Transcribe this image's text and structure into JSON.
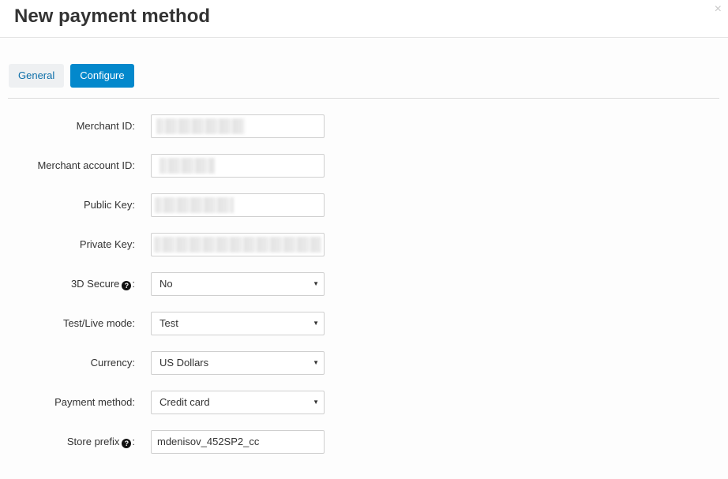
{
  "modal": {
    "title": "New payment method",
    "close_label": "×"
  },
  "tabs": [
    {
      "label": "General",
      "active": false
    },
    {
      "label": "Configure",
      "active": true
    }
  ],
  "form": {
    "merchant_id": {
      "label": "Merchant ID:",
      "value": "",
      "redacted": true
    },
    "merchant_account_id": {
      "label": "Merchant account ID:",
      "value": "",
      "redacted": true
    },
    "public_key": {
      "label": "Public Key:",
      "value": "",
      "redacted": true
    },
    "private_key": {
      "label": "Private Key:",
      "value": "",
      "redacted": true
    },
    "secure_3d": {
      "label": "3D Secure",
      "suffix": ":",
      "value": "No",
      "help": true
    },
    "mode": {
      "label": "Test/Live mode:",
      "value": "Test"
    },
    "currency": {
      "label": "Currency:",
      "value": "US Dollars"
    },
    "payment_method": {
      "label": "Payment method:",
      "value": "Credit card"
    },
    "store_prefix": {
      "label": "Store prefix",
      "suffix": ":",
      "value": "mdenisov_452SP2_cc",
      "help": true
    }
  },
  "icons": {
    "help": "question-circle-icon",
    "dropdown": "caret-down-icon",
    "close": "close-icon"
  },
  "colors": {
    "accent": "#0388cc",
    "tab_inactive_bg": "#eef0f2",
    "link": "#0d6fa9"
  }
}
